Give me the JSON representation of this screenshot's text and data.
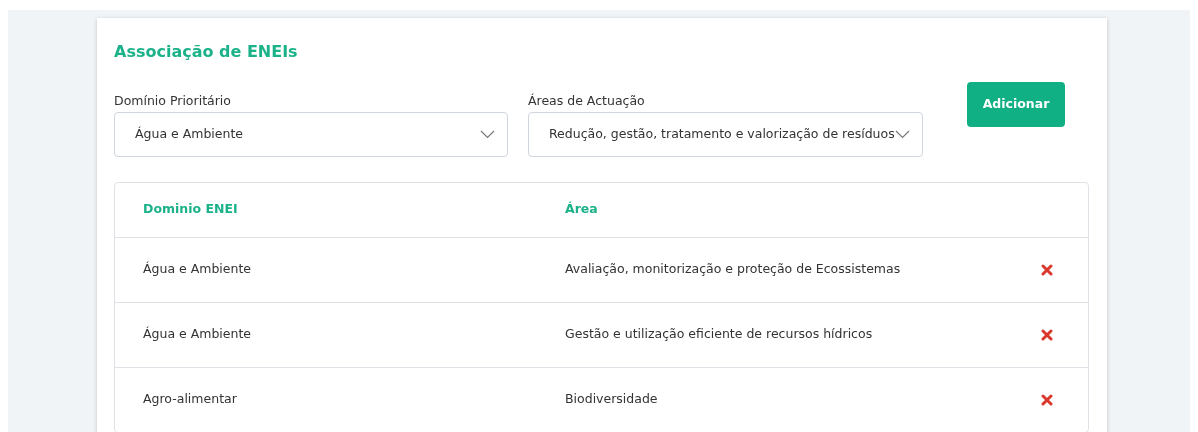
{
  "title": "Associação de ENEIs",
  "filters": [
    {
      "label": "Domínio Prioritário",
      "value": "Água e Ambiente"
    },
    {
      "label": "Áreas de Actuação",
      "value": "Redução, gestão, tratamento e valorização de resíduos"
    }
  ],
  "add_button": "Adicionar",
  "table": {
    "columns": [
      "Dominio ENEI",
      "Área"
    ],
    "rows": [
      {
        "domain": "Água e Ambiente",
        "area": "Avaliação, monitorização e proteção de Ecossistemas"
      },
      {
        "domain": "Água e Ambiente",
        "area": "Gestão e utilização eficiente de recursos hídricos"
      },
      {
        "domain": "Agro-alimentar",
        "area": "Biodiversidade"
      }
    ]
  }
}
